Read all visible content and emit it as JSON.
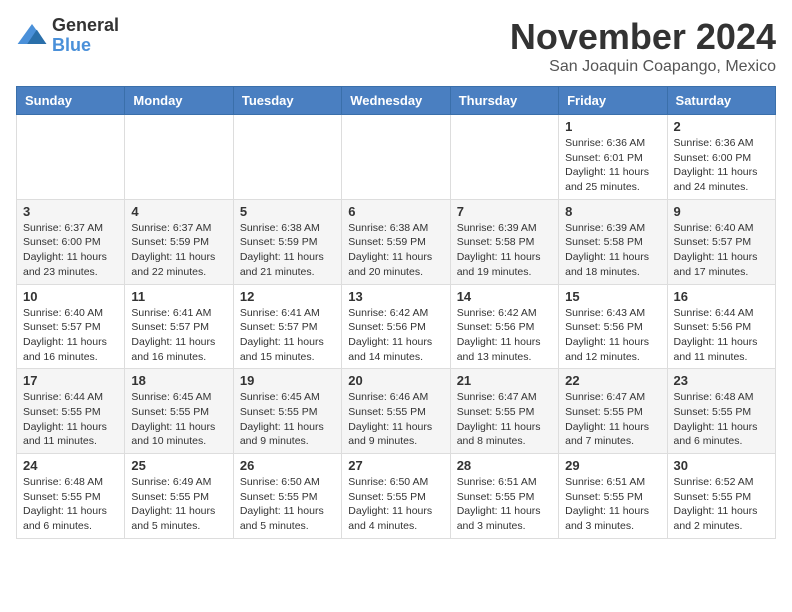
{
  "logo": {
    "general": "General",
    "blue": "Blue"
  },
  "title": "November 2024",
  "location": "San Joaquin Coapango, Mexico",
  "days_of_week": [
    "Sunday",
    "Monday",
    "Tuesday",
    "Wednesday",
    "Thursday",
    "Friday",
    "Saturday"
  ],
  "weeks": [
    [
      {
        "day": "",
        "info": ""
      },
      {
        "day": "",
        "info": ""
      },
      {
        "day": "",
        "info": ""
      },
      {
        "day": "",
        "info": ""
      },
      {
        "day": "",
        "info": ""
      },
      {
        "day": "1",
        "info": "Sunrise: 6:36 AM\nSunset: 6:01 PM\nDaylight: 11 hours and 25 minutes."
      },
      {
        "day": "2",
        "info": "Sunrise: 6:36 AM\nSunset: 6:00 PM\nDaylight: 11 hours and 24 minutes."
      }
    ],
    [
      {
        "day": "3",
        "info": "Sunrise: 6:37 AM\nSunset: 6:00 PM\nDaylight: 11 hours and 23 minutes."
      },
      {
        "day": "4",
        "info": "Sunrise: 6:37 AM\nSunset: 5:59 PM\nDaylight: 11 hours and 22 minutes."
      },
      {
        "day": "5",
        "info": "Sunrise: 6:38 AM\nSunset: 5:59 PM\nDaylight: 11 hours and 21 minutes."
      },
      {
        "day": "6",
        "info": "Sunrise: 6:38 AM\nSunset: 5:59 PM\nDaylight: 11 hours and 20 minutes."
      },
      {
        "day": "7",
        "info": "Sunrise: 6:39 AM\nSunset: 5:58 PM\nDaylight: 11 hours and 19 minutes."
      },
      {
        "day": "8",
        "info": "Sunrise: 6:39 AM\nSunset: 5:58 PM\nDaylight: 11 hours and 18 minutes."
      },
      {
        "day": "9",
        "info": "Sunrise: 6:40 AM\nSunset: 5:57 PM\nDaylight: 11 hours and 17 minutes."
      }
    ],
    [
      {
        "day": "10",
        "info": "Sunrise: 6:40 AM\nSunset: 5:57 PM\nDaylight: 11 hours and 16 minutes."
      },
      {
        "day": "11",
        "info": "Sunrise: 6:41 AM\nSunset: 5:57 PM\nDaylight: 11 hours and 16 minutes."
      },
      {
        "day": "12",
        "info": "Sunrise: 6:41 AM\nSunset: 5:57 PM\nDaylight: 11 hours and 15 minutes."
      },
      {
        "day": "13",
        "info": "Sunrise: 6:42 AM\nSunset: 5:56 PM\nDaylight: 11 hours and 14 minutes."
      },
      {
        "day": "14",
        "info": "Sunrise: 6:42 AM\nSunset: 5:56 PM\nDaylight: 11 hours and 13 minutes."
      },
      {
        "day": "15",
        "info": "Sunrise: 6:43 AM\nSunset: 5:56 PM\nDaylight: 11 hours and 12 minutes."
      },
      {
        "day": "16",
        "info": "Sunrise: 6:44 AM\nSunset: 5:56 PM\nDaylight: 11 hours and 11 minutes."
      }
    ],
    [
      {
        "day": "17",
        "info": "Sunrise: 6:44 AM\nSunset: 5:55 PM\nDaylight: 11 hours and 11 minutes."
      },
      {
        "day": "18",
        "info": "Sunrise: 6:45 AM\nSunset: 5:55 PM\nDaylight: 11 hours and 10 minutes."
      },
      {
        "day": "19",
        "info": "Sunrise: 6:45 AM\nSunset: 5:55 PM\nDaylight: 11 hours and 9 minutes."
      },
      {
        "day": "20",
        "info": "Sunrise: 6:46 AM\nSunset: 5:55 PM\nDaylight: 11 hours and 9 minutes."
      },
      {
        "day": "21",
        "info": "Sunrise: 6:47 AM\nSunset: 5:55 PM\nDaylight: 11 hours and 8 minutes."
      },
      {
        "day": "22",
        "info": "Sunrise: 6:47 AM\nSunset: 5:55 PM\nDaylight: 11 hours and 7 minutes."
      },
      {
        "day": "23",
        "info": "Sunrise: 6:48 AM\nSunset: 5:55 PM\nDaylight: 11 hours and 6 minutes."
      }
    ],
    [
      {
        "day": "24",
        "info": "Sunrise: 6:48 AM\nSunset: 5:55 PM\nDaylight: 11 hours and 6 minutes."
      },
      {
        "day": "25",
        "info": "Sunrise: 6:49 AM\nSunset: 5:55 PM\nDaylight: 11 hours and 5 minutes."
      },
      {
        "day": "26",
        "info": "Sunrise: 6:50 AM\nSunset: 5:55 PM\nDaylight: 11 hours and 5 minutes."
      },
      {
        "day": "27",
        "info": "Sunrise: 6:50 AM\nSunset: 5:55 PM\nDaylight: 11 hours and 4 minutes."
      },
      {
        "day": "28",
        "info": "Sunrise: 6:51 AM\nSunset: 5:55 PM\nDaylight: 11 hours and 3 minutes."
      },
      {
        "day": "29",
        "info": "Sunrise: 6:51 AM\nSunset: 5:55 PM\nDaylight: 11 hours and 3 minutes."
      },
      {
        "day": "30",
        "info": "Sunrise: 6:52 AM\nSunset: 5:55 PM\nDaylight: 11 hours and 2 minutes."
      }
    ]
  ]
}
